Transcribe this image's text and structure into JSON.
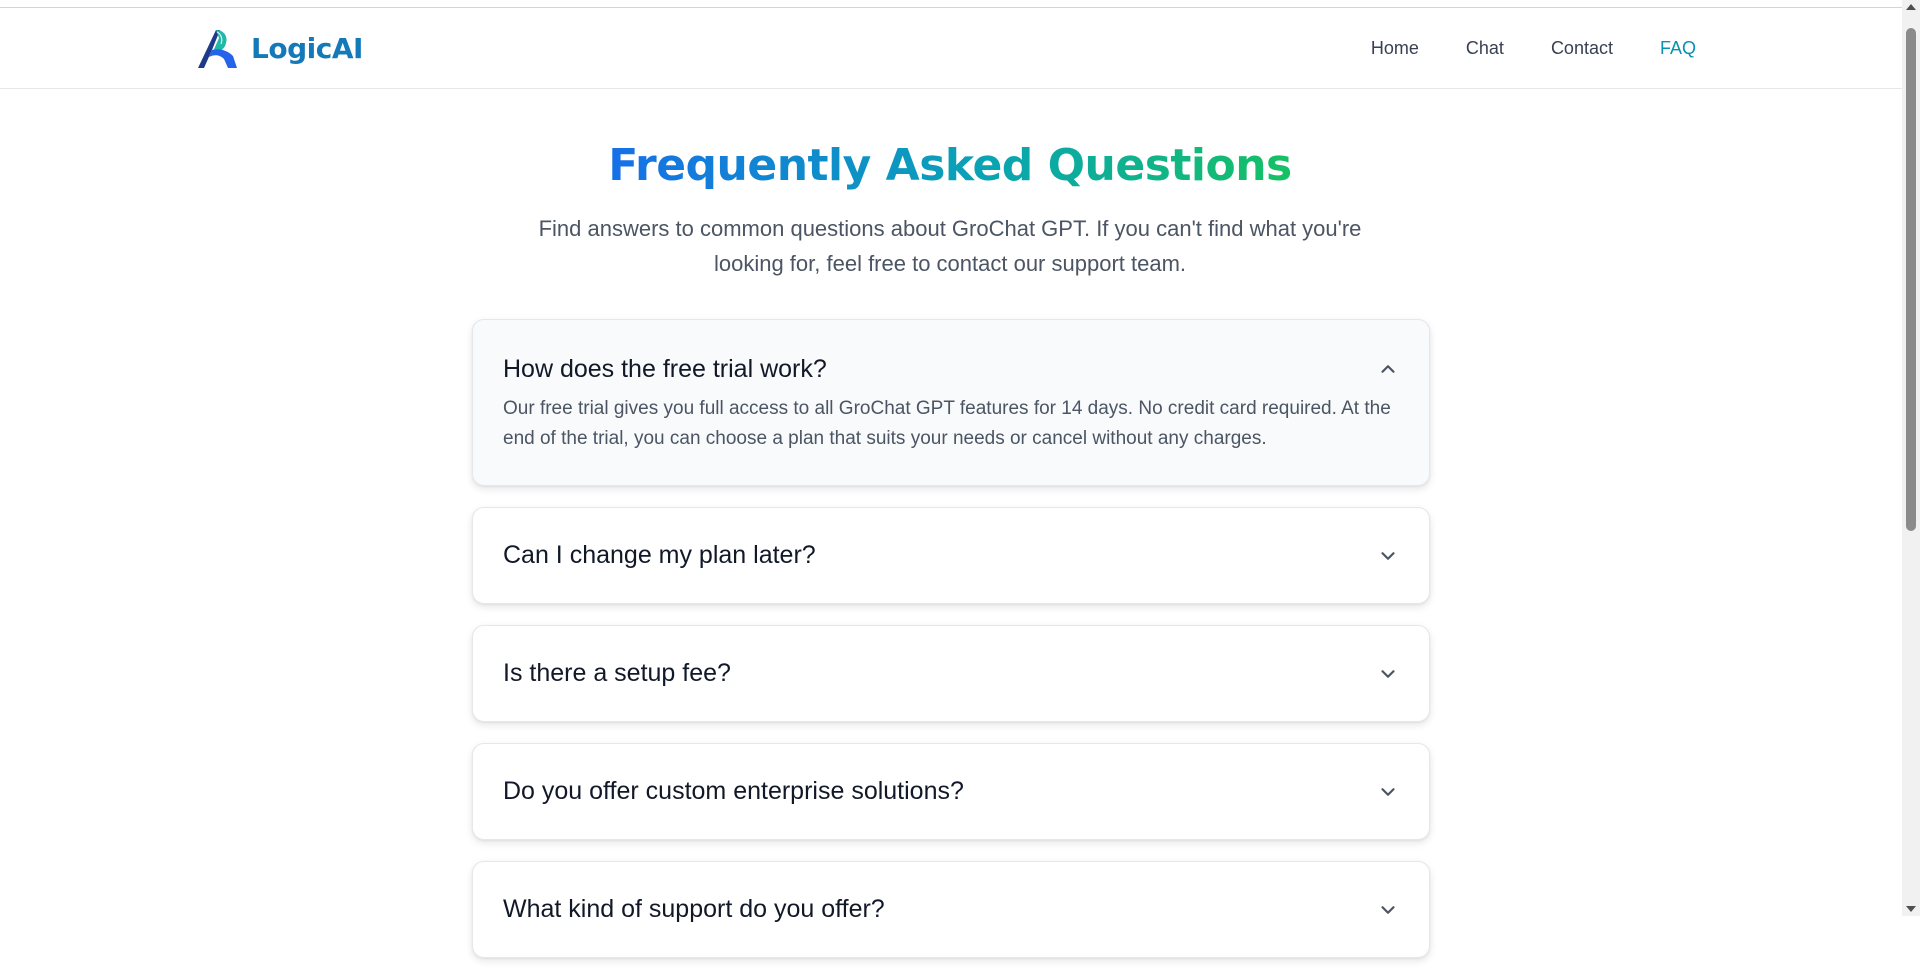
{
  "nav": {
    "brand": "LogicAI",
    "links": [
      "Home",
      "Chat",
      "Contact",
      "FAQ"
    ],
    "active_link": "FAQ"
  },
  "hero": {
    "title_part1": "Frequently ",
    "title_part2": "Asked ",
    "title_part3": "Questions",
    "subtitle": "Find answers to common questions about GroChat GPT. If you can't find what you're looking for, feel free to contact our support team."
  },
  "faq": {
    "items": [
      {
        "question": "How does the free trial work?",
        "answer": "Our free trial gives you full access to all GroChat GPT features for 14 days. No credit card required. At the end of the trial, you can choose a plan that suits your needs or cancel without any charges.",
        "expanded": true
      },
      {
        "question": "Can I change my plan later?",
        "expanded": false
      },
      {
        "question": "Is there a setup fee?",
        "expanded": false
      },
      {
        "question": "Do you offer custom enterprise solutions?",
        "expanded": false
      },
      {
        "question": "What kind of support do you offer?",
        "expanded": false
      }
    ]
  },
  "colors": {
    "brand": "#1479b8",
    "nav_active": "#0891b2",
    "title_gradient_start": "#1670e8",
    "title_gradient_end": "#16c163"
  },
  "icons": {
    "logo": "logicai-logo-icon",
    "expanded": "chevron-up-icon",
    "collapsed": "chevron-down-icon"
  }
}
